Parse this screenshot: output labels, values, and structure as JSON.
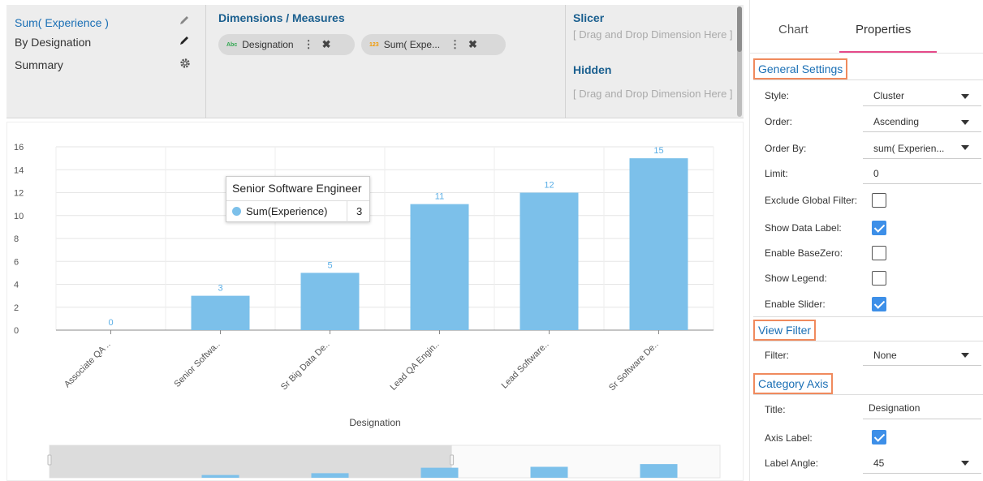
{
  "left_list": {
    "items": [
      {
        "label": "Sum( Experience )",
        "icon": "pencil-icon"
      },
      {
        "label": "By Designation",
        "icon": "pencil-icon"
      },
      {
        "label": "Summary",
        "icon": "gear-icon"
      }
    ]
  },
  "dimensions": {
    "title": "Dimensions / Measures",
    "pills": [
      {
        "type_tag": "Abc",
        "label": "Designation"
      },
      {
        "type_tag": "123",
        "label": "Sum( Expe..."
      }
    ]
  },
  "slicer": {
    "title": "Slicer",
    "drop_text": "[ Drag and Drop Dimension Here ]"
  },
  "hidden": {
    "title": "Hidden",
    "drop_text": "[ Drag and Drop Dimension Here ]"
  },
  "tooltip": {
    "title": "Senior Software Engineer",
    "series": "Sum(Experience)",
    "value": "3"
  },
  "colors": {
    "bar": "#7cc0ea",
    "label": "#5aaee6",
    "accent_tab": "#e54a8a",
    "group_border": "#f08a5d",
    "checkbox": "#3d8fe8"
  },
  "chart_data": {
    "type": "bar",
    "categories": [
      "Associate QA ..",
      "Senior Softwa..",
      "Sr Big Data De..",
      "Lead QA Engin..",
      "Lead Software..",
      "Sr Software De.."
    ],
    "values": [
      0,
      3,
      5,
      11,
      12,
      15
    ],
    "data_labels": [
      "0",
      "3",
      "5",
      "11",
      "12",
      "15"
    ],
    "y_ticks": [
      "0",
      "2",
      "4",
      "6",
      "8",
      "10",
      "12",
      "14",
      "16"
    ],
    "ylim": [
      0,
      16
    ],
    "xlabel": "Designation",
    "ylabel": "",
    "label_angle": 45,
    "grid": true,
    "slider": true
  },
  "properties": {
    "tabs": [
      "Chart",
      "Properties"
    ],
    "active_tab": "Properties",
    "general": {
      "title": "General Settings",
      "style_label": "Style:",
      "style_value": "Cluster",
      "order_label": "Order:",
      "order_value": "Ascending",
      "order_by_label": "Order By:",
      "order_by_value": "sum( Experien...",
      "limit_label": "Limit:",
      "limit_value": "0",
      "exclude_label": "Exclude Global Filter:",
      "exclude_checked": false,
      "data_label_label": "Show Data Label:",
      "data_label_checked": true,
      "basezero_label": "Enable BaseZero:",
      "basezero_checked": false,
      "legend_label": "Show Legend:",
      "legend_checked": false,
      "slider_label": "Enable Slider:",
      "slider_checked": true
    },
    "view_filter": {
      "title": "View Filter",
      "filter_label": "Filter:",
      "filter_value": "None"
    },
    "category_axis": {
      "title": "Category Axis",
      "title_label": "Title:",
      "title_value": "Designation",
      "axis_label_label": "Axis Label:",
      "axis_label_checked": true,
      "angle_label": "Label Angle:",
      "angle_value": "45"
    }
  }
}
